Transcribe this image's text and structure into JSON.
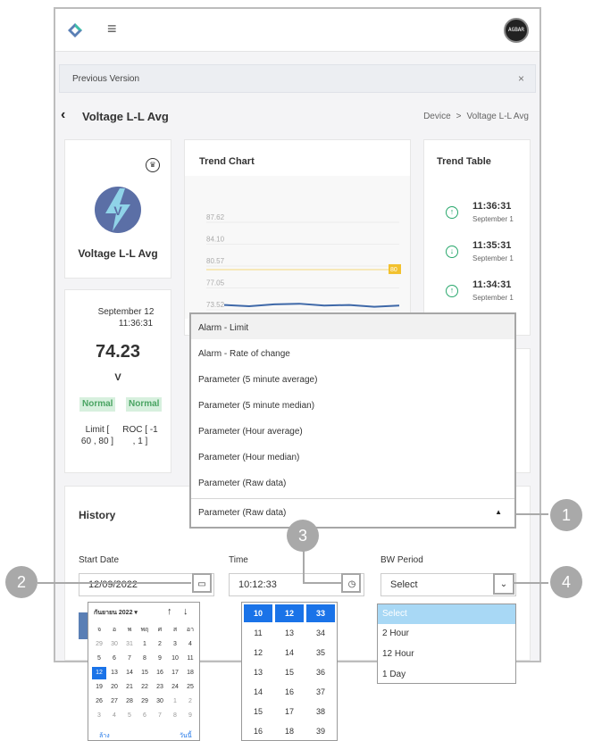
{
  "topbar": {
    "avatar_text": "AGBAR"
  },
  "notice": {
    "text": "Previous Version",
    "close": "×"
  },
  "page": {
    "back": "‹",
    "title": "Voltage L-L Avg"
  },
  "breadcrumb": {
    "root": "Device",
    "sep": ">",
    "current": "Voltage L-L Avg"
  },
  "device_card": {
    "name": "Voltage L-L Avg"
  },
  "value_card": {
    "date": "September 12",
    "time": "11:36:31",
    "value": "74.23",
    "unit": "V",
    "badge1": "Normal",
    "badge2": "Normal",
    "limit": "Limit [",
    "limit2": "60 , 80 ]",
    "roc": "ROC [ -1",
    "roc2": ", 1 ]"
  },
  "trend_chart": {
    "title": "Trend Chart",
    "limit_tag": "80"
  },
  "chart_data": {
    "type": "line",
    "title": "Trend Chart",
    "y_ticks": [
      "87.62",
      "84.10",
      "80.57",
      "77.05",
      "73.52"
    ],
    "ylim": [
      73.52,
      87.62
    ],
    "limit_line": 80,
    "series": [
      {
        "values": [
          74.3,
          74.1,
          74.4,
          74.5,
          74.2,
          74.3,
          74.0,
          74.2
        ]
      }
    ]
  },
  "trend_table": {
    "title": "Trend Table",
    "rows": [
      {
        "time": "11:36:31",
        "date": "September 1"
      },
      {
        "time": "11:35:31",
        "date": "September 1"
      },
      {
        "time": "11:34:31",
        "date": "September 1"
      }
    ]
  },
  "dropdown": {
    "items": [
      "Alarm - Limit",
      "Alarm - Rate of change",
      "Parameter (5 minute average)",
      "Parameter (5 minute median)",
      "Parameter (Hour average)",
      "Parameter (Hour median)",
      "Parameter (Raw data)"
    ],
    "selected": "Parameter (Raw data)"
  },
  "history": {
    "title": "History",
    "start_date_label": "Start Date",
    "start_date_value": "12/09/2022",
    "time_label": "Time",
    "time_value": "10:12:33",
    "bw_label": "BW Period",
    "bw_value": "Select"
  },
  "callouts": {
    "c1": "1",
    "c2": "2",
    "c3": "3",
    "c4": "4"
  },
  "calendar": {
    "month": "กันยายน 2022 ▾",
    "up": "↑",
    "down": "↓",
    "weekdays": [
      "จ",
      "อ",
      "พ",
      "พฤ",
      "ศ",
      "ส",
      "อา"
    ],
    "weeks": [
      [
        "29",
        "30",
        "31",
        "1",
        "2",
        "3",
        "4"
      ],
      [
        "5",
        "6",
        "7",
        "8",
        "9",
        "10",
        "11"
      ],
      [
        "12",
        "13",
        "14",
        "15",
        "16",
        "17",
        "18"
      ],
      [
        "19",
        "20",
        "21",
        "22",
        "23",
        "24",
        "25"
      ],
      [
        "26",
        "27",
        "28",
        "29",
        "30",
        "1",
        "2"
      ],
      [
        "3",
        "4",
        "5",
        "6",
        "7",
        "8",
        "9"
      ]
    ],
    "clear": "ล้าง",
    "today": "วันนี้"
  },
  "time_picker": {
    "hours": [
      "10",
      "11",
      "12",
      "13",
      "14",
      "15",
      "16"
    ],
    "minutes": [
      "12",
      "13",
      "14",
      "15",
      "16",
      "17",
      "18"
    ],
    "seconds": [
      "33",
      "34",
      "35",
      "36",
      "37",
      "38",
      "39"
    ]
  },
  "bw_options": [
    "Select",
    "2 Hour",
    "12 Hour",
    "1 Day"
  ]
}
